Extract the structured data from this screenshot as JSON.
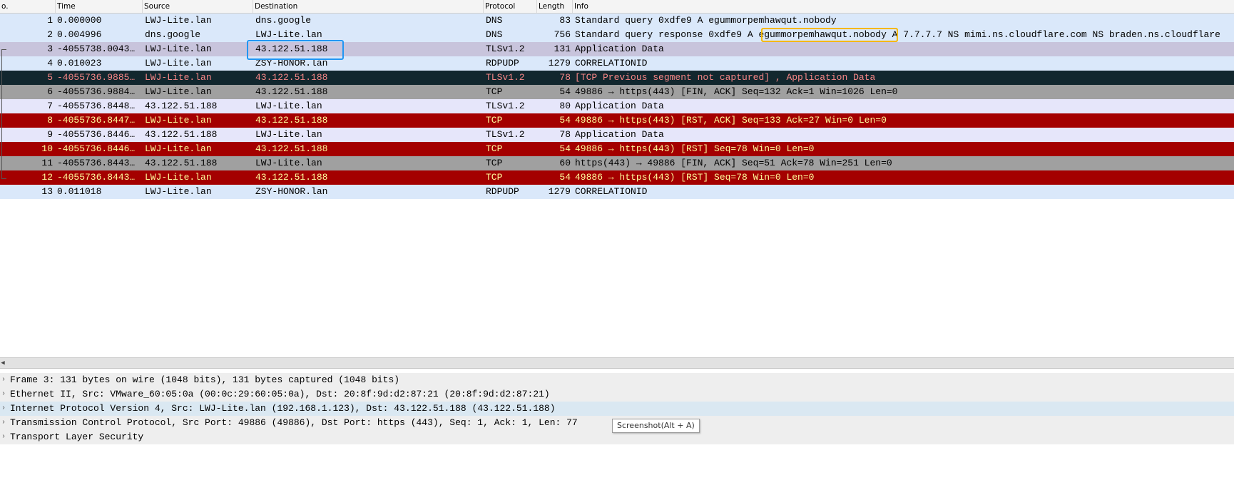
{
  "columns": {
    "no": "o.",
    "time": "Time",
    "source": "Source",
    "destination": "Destination",
    "protocol": "Protocol",
    "length": "Length",
    "info": "Info"
  },
  "colors": {
    "dns_bg": "#dae8fa",
    "tls_selected_bg": "#c8c4dc",
    "tls_bg": "#e6e6fa",
    "rdp_bg": "#dae8fa",
    "dark_bg": "#12272e",
    "dark_fg": "#f78787",
    "tcp_fin_bg": "#a0a0a0",
    "rst_bg": "#a40000",
    "rst_fg": "#fffc9c",
    "blue_box": "#2196f3",
    "orange_box": "#f5b800",
    "green_box": "#1aa31a"
  },
  "packets": [
    {
      "no": "1",
      "time": "0.000000",
      "source": "LWJ-Lite.lan",
      "destination": "dns.google",
      "protocol": "DNS",
      "length": "83",
      "info": "Standard query 0xdfe9 A egummorpemhawqut.nobody",
      "style": "dns"
    },
    {
      "no": "2",
      "time": "0.004996",
      "source": "dns.google",
      "destination": "LWJ-Lite.lan",
      "protocol": "DNS",
      "length": "756",
      "info": "Standard query response 0xdfe9 A egummorpemhawqut.nobody A 7.7.7.7 NS mimi.ns.cloudflare.com NS braden.ns.cloudflare",
      "style": "dns"
    },
    {
      "no": "3",
      "time": "-4055738.0043…",
      "source": "LWJ-Lite.lan",
      "destination": "43.122.51.188",
      "protocol": "TLSv1.2",
      "length": "131",
      "info": "Application Data",
      "style": "tls_selected"
    },
    {
      "no": "4",
      "time": "0.010023",
      "source": "LWJ-Lite.lan",
      "destination": "ZSY-HONOR.lan",
      "protocol": "RDPUDP",
      "length": "1279",
      "info": "CORRELATIONID",
      "style": "rdp"
    },
    {
      "no": "5",
      "time": "-4055736.9885…",
      "source": "LWJ-Lite.lan",
      "destination": "43.122.51.188",
      "protocol": "TLSv1.2",
      "length": "78",
      "info": "[TCP Previous segment not captured] , Application Data",
      "style": "dark"
    },
    {
      "no": "6",
      "time": "-4055736.9884…",
      "source": "LWJ-Lite.lan",
      "destination": "43.122.51.188",
      "protocol": "TCP",
      "length": "54",
      "info": "49886 → https(443) [FIN, ACK] Seq=132 Ack=1 Win=1026 Len=0",
      "style": "tcp_fin"
    },
    {
      "no": "7",
      "time": "-4055736.8448…",
      "source": "43.122.51.188",
      "destination": "LWJ-Lite.lan",
      "protocol": "TLSv1.2",
      "length": "80",
      "info": "Application Data",
      "style": "tls"
    },
    {
      "no": "8",
      "time": "-4055736.8447…",
      "source": "LWJ-Lite.lan",
      "destination": "43.122.51.188",
      "protocol": "TCP",
      "length": "54",
      "info": "49886 → https(443) [RST, ACK] Seq=133 Ack=27 Win=0 Len=0",
      "style": "rst"
    },
    {
      "no": "9",
      "time": "-4055736.8446…",
      "source": "43.122.51.188",
      "destination": "LWJ-Lite.lan",
      "protocol": "TLSv1.2",
      "length": "78",
      "info": "Application Data",
      "style": "tls"
    },
    {
      "no": "10",
      "time": "-4055736.8446…",
      "source": "LWJ-Lite.lan",
      "destination": "43.122.51.188",
      "protocol": "TCP",
      "length": "54",
      "info": "49886 → https(443) [RST] Seq=78 Win=0 Len=0",
      "style": "rst"
    },
    {
      "no": "11",
      "time": "-4055736.8443…",
      "source": "43.122.51.188",
      "destination": "LWJ-Lite.lan",
      "protocol": "TCP",
      "length": "60",
      "info": "https(443) → 49886 [FIN, ACK] Seq=51 Ack=78 Win=251 Len=0",
      "style": "tcp_fin"
    },
    {
      "no": "12",
      "time": "-4055736.8443…",
      "source": "LWJ-Lite.lan",
      "destination": "43.122.51.188",
      "protocol": "TCP",
      "length": "54",
      "info": "49886 → https(443) [RST] Seq=78 Win=0 Len=0",
      "style": "rst"
    },
    {
      "no": "13",
      "time": "0.011018",
      "source": "LWJ-Lite.lan",
      "destination": "ZSY-HONOR.lan",
      "protocol": "RDPUDP",
      "length": "1279",
      "info": "CORRELATIONID",
      "style": "rdp"
    }
  ],
  "details": [
    {
      "text": "Frame 3: 131 bytes on wire (1048 bits), 131 bytes captured (1048 bits)",
      "style": "plain"
    },
    {
      "text": "Ethernet II, Src: VMware_60:05:0a (00:0c:29:60:05:0a), Dst: 20:8f:9d:d2:87:21 (20:8f:9d:d2:87:21)",
      "style": "plain"
    },
    {
      "text": "Internet Protocol Version 4, Src: LWJ-Lite.lan (192.168.1.123), Dst: 43.122.51.188 (43.122.51.188)",
      "style": "ip"
    },
    {
      "text": "Transmission Control Protocol, Src Port: 49886 (49886), Dst Port: https (443), Seq: 1, Ack: 1, Len: 77",
      "style": "plain"
    },
    {
      "text": "Transport Layer Security",
      "style": "plain"
    }
  ],
  "detail_colors": {
    "plain": "#eeeeee",
    "ip": "#dae8f2"
  },
  "tooltip": "Screenshot(Alt + A)"
}
